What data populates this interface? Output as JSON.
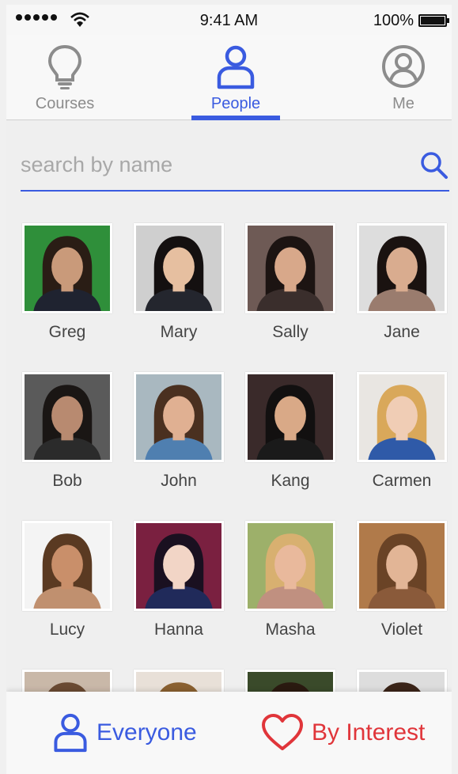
{
  "status_bar": {
    "time": "9:41 AM",
    "battery": "100%"
  },
  "tabs": [
    {
      "label": "Courses",
      "icon": "lightbulb-icon",
      "active": false
    },
    {
      "label": "People",
      "icon": "person-icon",
      "active": true
    },
    {
      "label": "Me",
      "icon": "user-circle-icon",
      "active": false
    }
  ],
  "search": {
    "placeholder": "search by name",
    "value": ""
  },
  "people": [
    {
      "name": "Greg",
      "bg": "#2f8f3a",
      "skin": "#c99a7a",
      "hair": "#2a1d15",
      "shirt": "#1f2330"
    },
    {
      "name": "Mary",
      "bg": "#cfcfcf",
      "skin": "#e6bfa0",
      "hair": "#141010",
      "shirt": "#24262e"
    },
    {
      "name": "Sally",
      "bg": "#6e5a55",
      "skin": "#d8a88a",
      "hair": "#1c1412",
      "shirt": "#3a2e2c"
    },
    {
      "name": "Jane",
      "bg": "#dddddd",
      "skin": "#d9ac8f",
      "hair": "#1a1210",
      "shirt": "#9a7c6e"
    },
    {
      "name": "Bob",
      "bg": "#5a5a5a",
      "skin": "#b88a70",
      "hair": "#1a1614",
      "shirt": "#2b2b2b"
    },
    {
      "name": "John",
      "bg": "#a9b8c0",
      "skin": "#e0b092",
      "hair": "#4a3020",
      "shirt": "#4f7fb0"
    },
    {
      "name": "Kang",
      "bg": "#3a2a2a",
      "skin": "#d9a987",
      "hair": "#121010",
      "shirt": "#1a1a1a"
    },
    {
      "name": "Carmen",
      "bg": "#e9e6e2",
      "skin": "#f0cdb5",
      "hair": "#d9a85a",
      "shirt": "#2f5aa8"
    },
    {
      "name": "Lucy",
      "bg": "#f4f4f4",
      "skin": "#c98f6a",
      "hair": "#5a3a22",
      "shirt": "#c0906f"
    },
    {
      "name": "Hanna",
      "bg": "#7a2040",
      "skin": "#f2d5c6",
      "hair": "#1a1020",
      "shirt": "#202a5a"
    },
    {
      "name": "Masha",
      "bg": "#9db06a",
      "skin": "#e9b99c",
      "hair": "#d8b070",
      "shirt": "#c09080"
    },
    {
      "name": "Violet",
      "bg": "#b07a4a",
      "skin": "#e2b596",
      "hair": "#6a4326",
      "shirt": "#8a5a3a"
    },
    {
      "name": "",
      "bg": "#c9b8a8",
      "skin": "#e0b092",
      "hair": "#6a4a32",
      "shirt": "#444"
    },
    {
      "name": "",
      "bg": "#e8e0d8",
      "skin": "#c9a07c",
      "hair": "#8a6030",
      "shirt": "#444"
    },
    {
      "name": "",
      "bg": "#3a4a2a",
      "skin": "#b08060",
      "hair": "#2a1a10",
      "shirt": "#444"
    },
    {
      "name": "",
      "bg": "#ddd",
      "skin": "#d0a888",
      "hair": "#3a2418",
      "shirt": "#444"
    }
  ],
  "bottom_bar": {
    "everyone_label": "Everyone",
    "interest_label": "By Interest"
  },
  "colors": {
    "accent": "#3a5be0",
    "heart": "#e0353a",
    "inactive": "#8c8c8c"
  }
}
